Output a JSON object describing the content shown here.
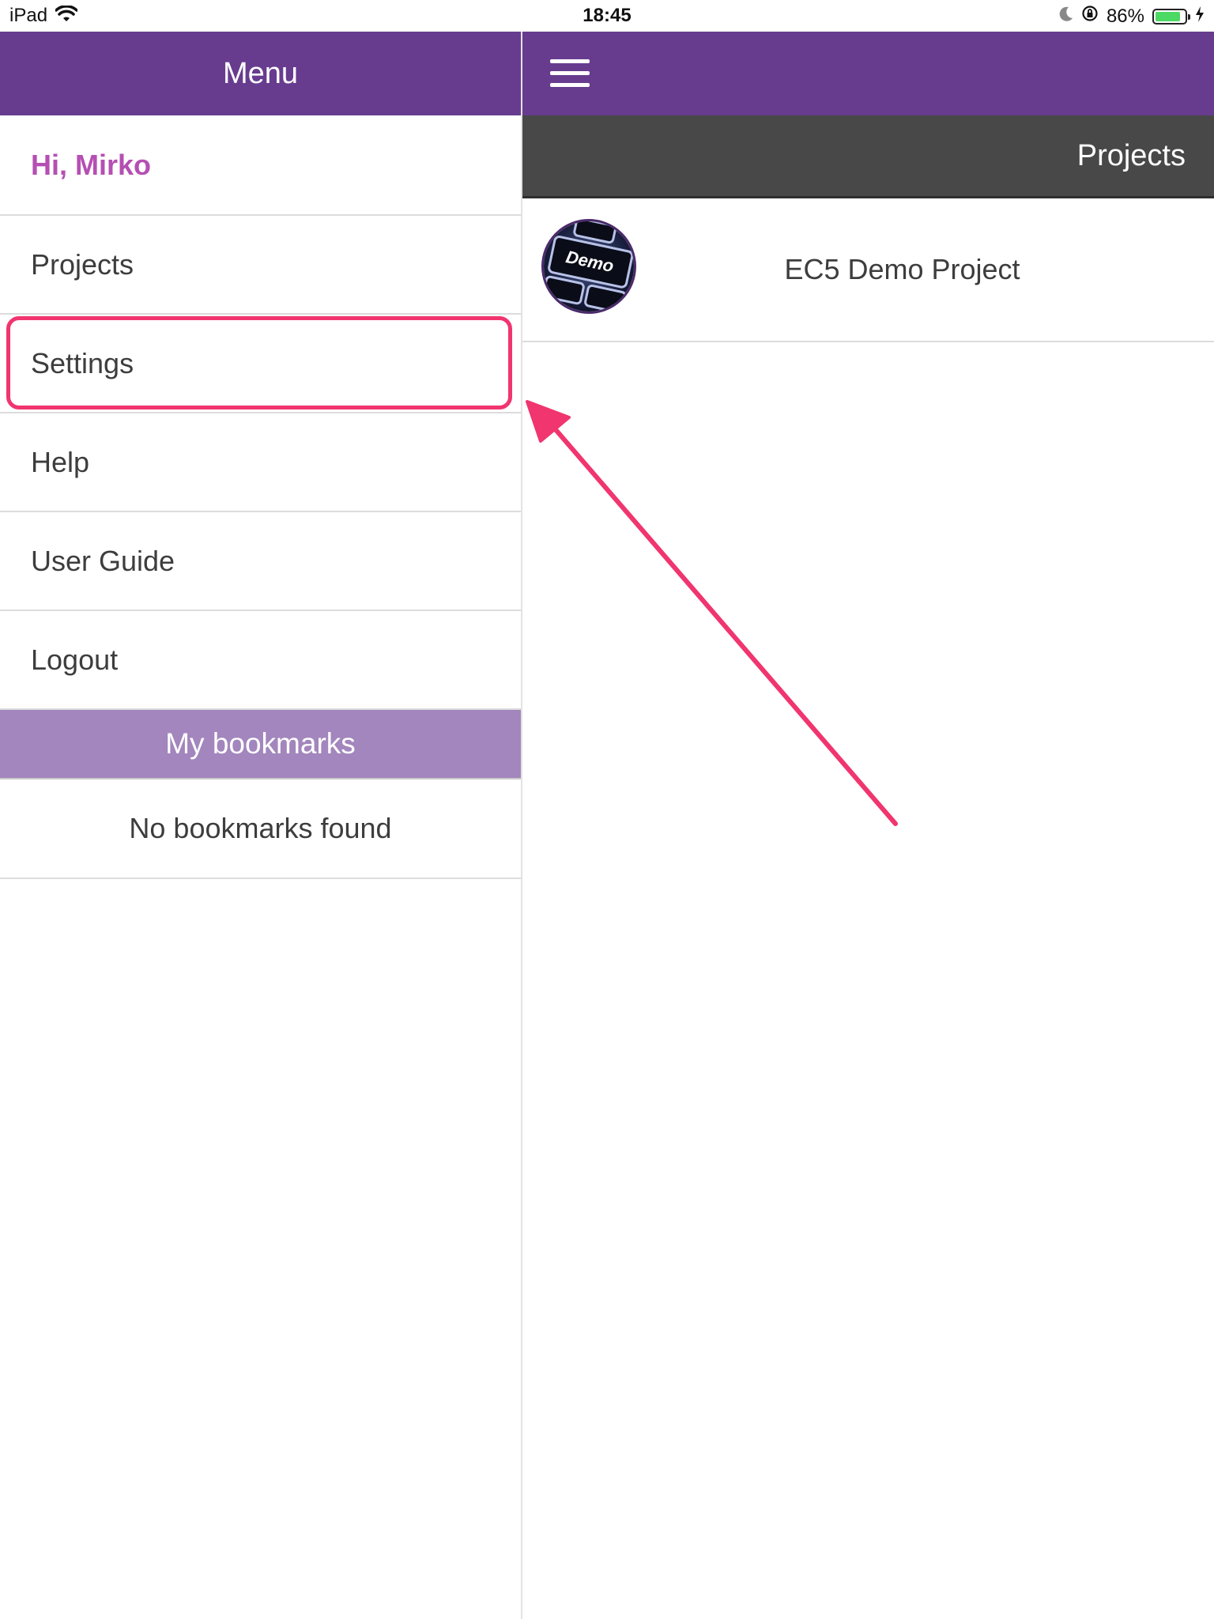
{
  "status_bar": {
    "device": "iPad",
    "time": "18:45",
    "battery_percent": "86%",
    "battery_level": 0.86,
    "icons": [
      "wifi-icon",
      "moon-icon",
      "rotation-lock-icon",
      "battery-icon",
      "charging-icon"
    ]
  },
  "menu": {
    "title": "Menu",
    "greeting": "Hi, Mirko",
    "items": [
      {
        "label": "Projects"
      },
      {
        "label": "Settings",
        "highlighted": true
      },
      {
        "label": "Help"
      },
      {
        "label": "User Guide"
      },
      {
        "label": "Logout"
      }
    ],
    "bookmarks": {
      "header": "My bookmarks",
      "empty_text": "No bookmarks found"
    }
  },
  "content": {
    "nav_icon": "hamburger-icon",
    "section_title": "Projects",
    "projects": [
      {
        "name": "EC5 Demo Project",
        "thumbnail_text": "Demo"
      }
    ]
  },
  "colors": {
    "brand_purple": "#673c8f",
    "bookmarks_purple": "#a386bd",
    "greeting_magenta": "#b54fb3",
    "annotation_pink": "#f0356f",
    "projects_bar": "#484848"
  }
}
